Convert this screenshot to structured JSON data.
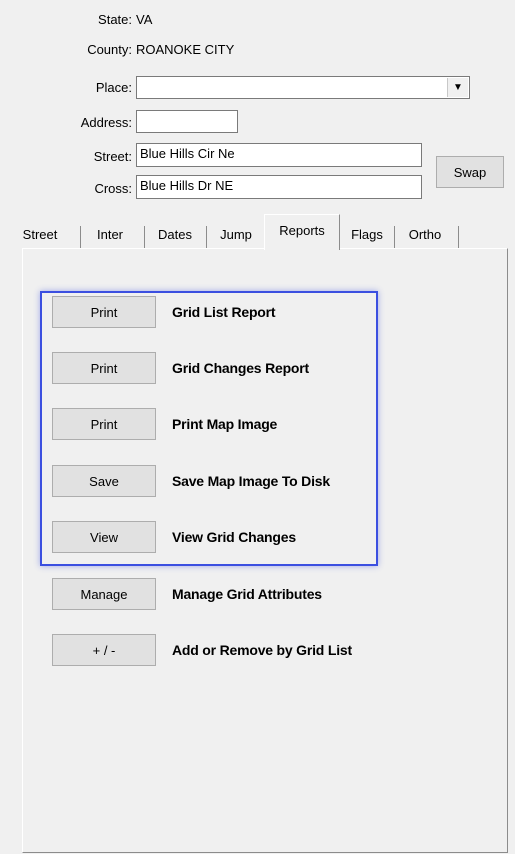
{
  "header": {
    "state_label": "State:",
    "state_value": "VA",
    "county_label": "County:",
    "county_value": "ROANOKE CITY",
    "place_label": "Place:",
    "place_value": "",
    "address_label": "Address:",
    "address_value": "",
    "street_label": "Street:",
    "street_value": "Blue Hills Cir Ne",
    "cross_label": "Cross:",
    "cross_value": "Blue Hills Dr NE",
    "swap_label": "Swap"
  },
  "tabs": [
    "Street",
    "Inter",
    "Dates",
    "Jump",
    "Reports",
    "Flags",
    "Ortho"
  ],
  "active_tab": "Reports",
  "actions": [
    {
      "button": "Print",
      "text": "Grid List Report"
    },
    {
      "button": "Print",
      "text": "Grid Changes Report"
    },
    {
      "button": "Print",
      "text": "Print Map Image"
    },
    {
      "button": "Save",
      "text": "Save Map Image To Disk"
    },
    {
      "button": "View",
      "text": "View Grid Changes"
    },
    {
      "button": "Manage",
      "text": "Manage Grid Attributes"
    },
    {
      "button": "+ / -",
      "text": "Add or Remove by Grid List"
    }
  ],
  "colors": {
    "highlight_border": "#3b4fe0",
    "background": "#f0f0f0"
  }
}
